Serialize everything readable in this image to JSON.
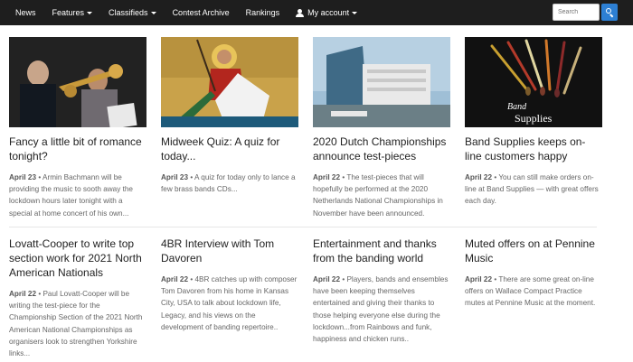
{
  "nav": {
    "items": [
      {
        "label": "News",
        "caret": false
      },
      {
        "label": "Features",
        "caret": true
      },
      {
        "label": "Classifieds",
        "caret": true
      },
      {
        "label": "Contest Archive",
        "caret": false
      },
      {
        "label": "Rankings",
        "caret": false
      }
    ],
    "account_label": "My account",
    "search_placeholder": "Search"
  },
  "articles": [
    {
      "title": "Fancy a little bit of romance tonight?",
      "date": "April 23",
      "excerpt": "Armin Bachmann will be providing the music to sooth away the lockdown hours later tonight with a special at home concert of his own...",
      "image": "trombone-players-photo"
    },
    {
      "title": "Midweek Quiz: A quiz for today...",
      "date": "April 23",
      "excerpt": "A quiz for today only to lance a few brass bands CDs...",
      "image": "saint-george-icon-painting"
    },
    {
      "title": "2020 Dutch Championships announce test-pieces",
      "date": "April 22",
      "excerpt": "The test-pieces that will hopefully be performed at the 2020 Netherlands National Championships in November have been announced.",
      "image": "modern-building-photo"
    },
    {
      "title": "Band Supplies keeps on-line customers happy",
      "date": "April 22",
      "excerpt": "You can still make orders on-line at Band Supplies — with great offers each day.",
      "image": "band-supplies-batons",
      "image_text_1": "Band",
      "image_text_2": "Supplies"
    },
    {
      "title": "Lovatt-Cooper to write top section work for 2021 North American Nationals",
      "date": "April 22",
      "excerpt": "Paul Lovatt-Cooper will be writing the test-piece for the Championship Section of the 2021 North American National Championships as organisers look to strengthen Yorkshire links..."
    },
    {
      "title": "4BR Interview with Tom Davoren",
      "date": "April 22",
      "excerpt": "4BR catches up with composer Tom Davoren from his home in Kansas City, USA to talk about lockdown life, Legacy, and his views on the development of banding repertoire.."
    },
    {
      "title": "Entertainment and thanks from the banding world",
      "date": "April 22",
      "excerpt": "Players, bands and ensembles have been keeping themselves entertained and giving their thanks to those helping everyone else during the lockdown...from Rainbows and funk, happiness and chicken runs.."
    },
    {
      "title": "Muted offers on at Pennine Music",
      "date": "April 22",
      "excerpt": "There are some great on-line offers on Wallace Compact Practice mutes at Pennine Music at the moment."
    }
  ]
}
